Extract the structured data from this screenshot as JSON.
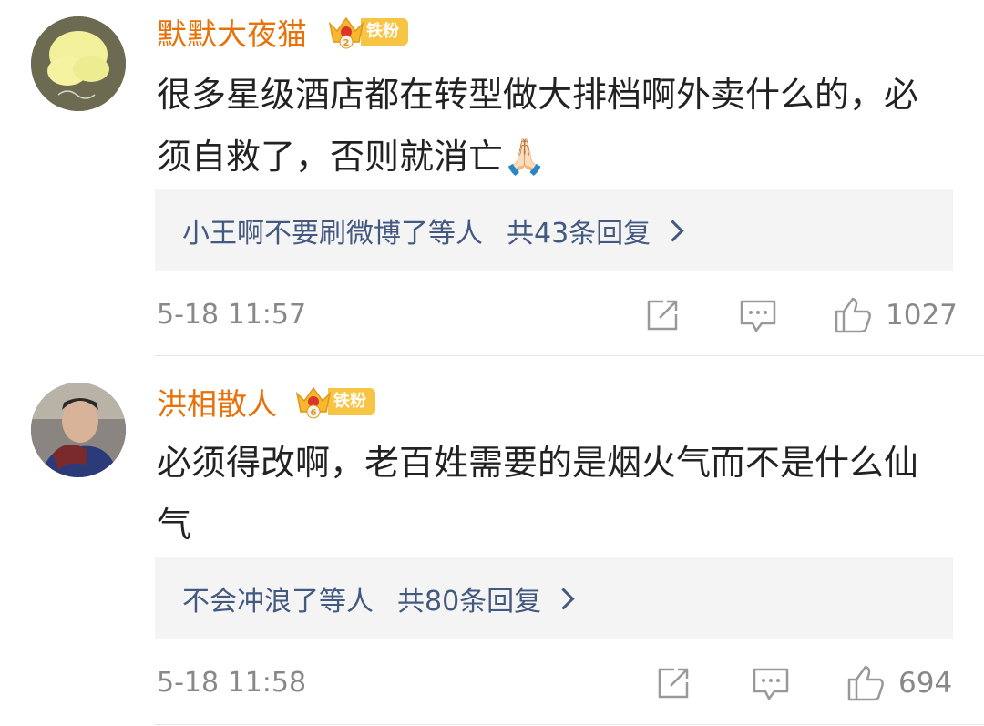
{
  "comments": [
    {
      "username": "默默大夜猫",
      "fan_level": "2",
      "fan_label": "铁粉",
      "text": "很多星级酒店都在转型做大排档啊外卖什么的，必须自救了，否则就消亡🙏🏻",
      "reply_users": "小王啊不要刷微博了等人",
      "reply_count": "共43条回复",
      "timestamp": "5-18 11:57",
      "likes": "1027"
    },
    {
      "username": "洪相散人",
      "fan_level": "6",
      "fan_label": "铁粉",
      "text": "必须得改啊，老百姓需要的是烟火气而不是什么仙气",
      "reply_users": "不会冲浪了等人",
      "reply_count": "共80条回复",
      "timestamp": "5-18 11:58",
      "likes": "694"
    }
  ],
  "colors": {
    "username": "#e8710a",
    "reply_link": "#44597f",
    "badge": "#f7c443",
    "meta_text": "#888888"
  },
  "icons": [
    "share-icon",
    "comment-icon",
    "like-icon",
    "crown-icon"
  ]
}
